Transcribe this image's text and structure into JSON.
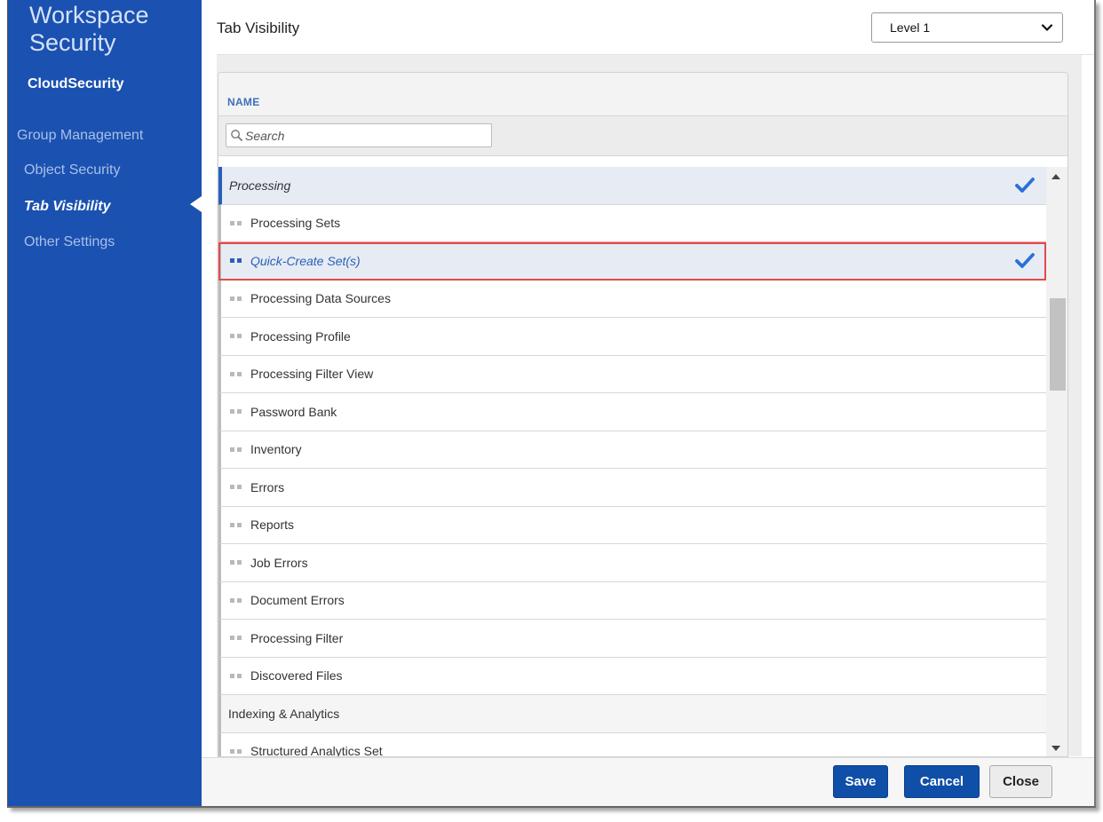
{
  "sidebar": {
    "title_line1": "Workspace",
    "title_line2": "Security",
    "subtitle": "CloudSecurity",
    "items": [
      {
        "label": "Group Management"
      },
      {
        "label": "Object Security"
      },
      {
        "label": "Tab Visibility",
        "active": true
      },
      {
        "label": "Other Settings"
      }
    ]
  },
  "header": {
    "title": "Tab Visibility",
    "level_select": {
      "value": "Level 1"
    }
  },
  "grid": {
    "column_name": "NAME",
    "search_placeholder": "Search",
    "rows": [
      {
        "label": "Processing",
        "type": "group",
        "selected": true,
        "checked": true
      },
      {
        "label": "Processing Sets",
        "type": "child",
        "selected": false,
        "checked": false
      },
      {
        "label": "Quick-Create Set(s)",
        "type": "child",
        "selected": true,
        "checked": true,
        "highlighted": true
      },
      {
        "label": "Processing Data Sources",
        "type": "child"
      },
      {
        "label": "Processing Profile",
        "type": "child"
      },
      {
        "label": "Processing Filter View",
        "type": "child"
      },
      {
        "label": "Password Bank",
        "type": "child"
      },
      {
        "label": "Inventory",
        "type": "child"
      },
      {
        "label": "Errors",
        "type": "child"
      },
      {
        "label": "Reports",
        "type": "child"
      },
      {
        "label": "Job Errors",
        "type": "child"
      },
      {
        "label": "Document Errors",
        "type": "child"
      },
      {
        "label": "Processing Filter",
        "type": "child"
      },
      {
        "label": "Discovered Files",
        "type": "child"
      },
      {
        "label": "Indexing & Analytics",
        "type": "group"
      },
      {
        "label": "Structured Analytics Set",
        "type": "child"
      }
    ]
  },
  "footer": {
    "save_label": "Save",
    "cancel_label": "Cancel",
    "close_label": "Close"
  },
  "colors": {
    "sidebar_bg": "#1b51b0",
    "primary_button": "#0f4fa8",
    "check": "#2a70d6",
    "highlight_outline": "#e04b4b"
  },
  "icons": {
    "search": "magnifier-icon",
    "check": "checkmark-icon",
    "select_caret": "chevron-down-icon",
    "drag": "drag-handle-icon"
  }
}
